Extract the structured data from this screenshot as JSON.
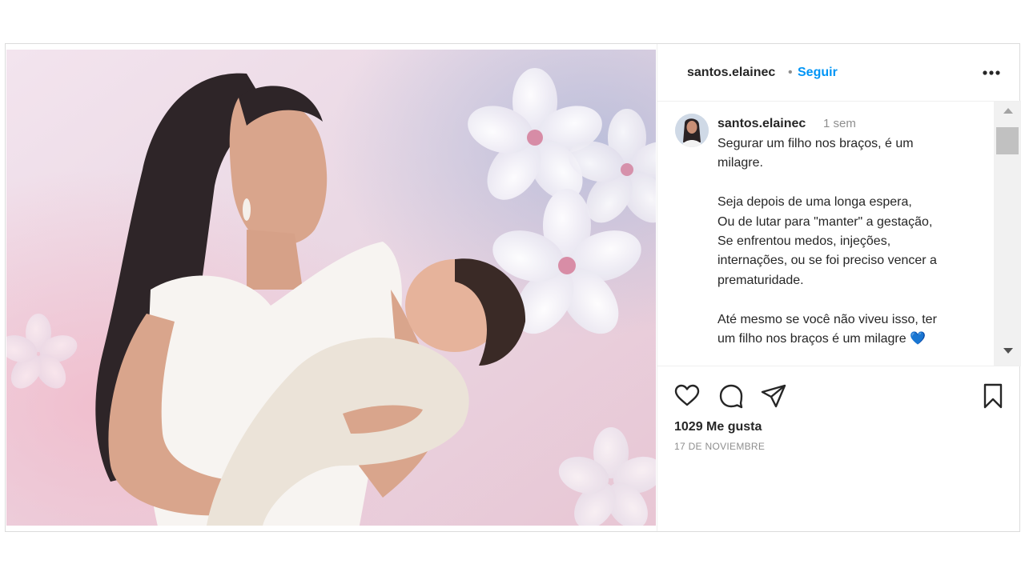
{
  "post": {
    "username": "santos.elainec",
    "separator": "•",
    "follow_label": "Seguir",
    "more_icon": "more-horizontal-icon",
    "caption": {
      "username": "santos.elainec",
      "time": "1 sem",
      "lines": [
        "Segurar um filho nos braços, é um",
        "milagre.",
        "",
        "Seja depois de uma longa espera,",
        "Ou de lutar para \"manter\" a gestação,",
        "Se enfrentou medos, injeções,",
        "internações, ou se foi preciso vencer a",
        "prematuridade.",
        "",
        "Até mesmo se você não viveu isso, ter",
        "um filho nos braços é um milagre"
      ],
      "emoji": "💙"
    },
    "likes_label": "1029 Me gusta",
    "date_label": "17 DE NOVIEMBRE"
  },
  "icons": {
    "like": "heart-icon",
    "comment": "comment-icon",
    "share": "send-icon",
    "save": "bookmark-icon"
  },
  "colors": {
    "link_blue": "#0095f6",
    "text": "#262626",
    "muted": "#8e8e8e",
    "border": "#dbdbdb"
  }
}
